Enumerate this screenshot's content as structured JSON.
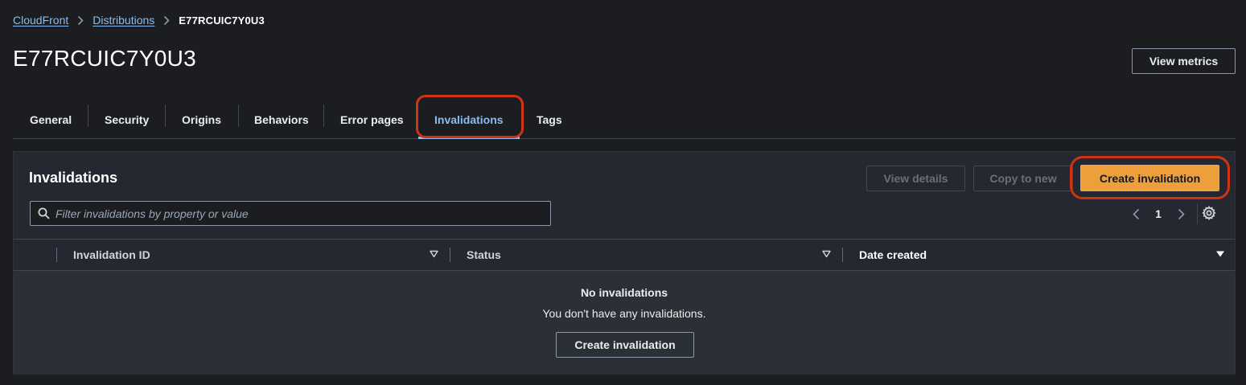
{
  "breadcrumb": {
    "items": [
      {
        "label": "CloudFront"
      },
      {
        "label": "Distributions"
      }
    ],
    "current": "E77RCUIC7Y0U3"
  },
  "page": {
    "title": "E77RCUIC7Y0U3",
    "view_metrics_label": "View metrics"
  },
  "tabs": [
    {
      "label": "General",
      "active": false
    },
    {
      "label": "Security",
      "active": false
    },
    {
      "label": "Origins",
      "active": false
    },
    {
      "label": "Behaviors",
      "active": false
    },
    {
      "label": "Error pages",
      "active": false
    },
    {
      "label": "Invalidations",
      "active": true
    },
    {
      "label": "Tags",
      "active": false
    }
  ],
  "panel": {
    "title": "Invalidations",
    "actions": {
      "view_details": "View details",
      "copy_to_new": "Copy to new",
      "create_invalidation": "Create invalidation"
    },
    "filter": {
      "placeholder": "Filter invalidations by property or value",
      "value": ""
    },
    "pagination": {
      "current_page": "1"
    },
    "table": {
      "columns": [
        "Invalidation ID",
        "Status",
        "Date created"
      ],
      "rows": [],
      "empty": {
        "title": "No invalidations",
        "description": "You don't have any invalidations.",
        "button": "Create invalidation"
      }
    }
  },
  "icons": {
    "breadcrumb_separator": "chevron-right-icon",
    "search": "search-icon",
    "pager_prev": "chevron-left-icon",
    "pager_next": "chevron-right-icon",
    "settings": "gear-icon",
    "sort": "caret-down-icon"
  },
  "colors": {
    "background": "#1c1d21",
    "panel": "#252830",
    "link": "#89bdf1",
    "primary_button": "#ec9f3a",
    "annotation": "#d13212"
  }
}
